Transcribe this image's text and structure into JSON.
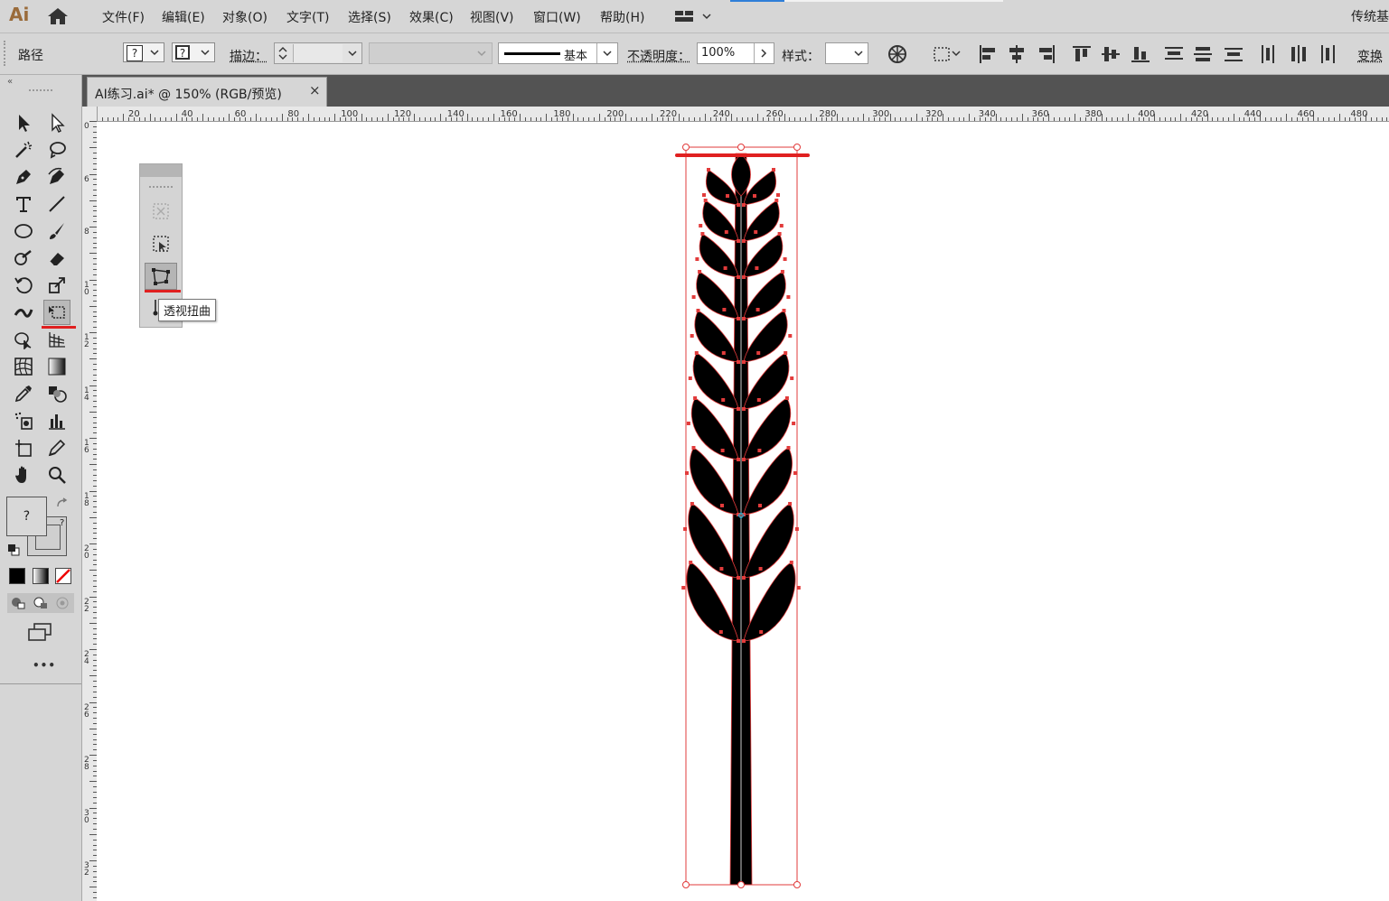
{
  "app": {
    "logo": "Ai",
    "workspace": "传统基"
  },
  "menu": [
    "文件(F)",
    "编辑(E)",
    "对象(O)",
    "文字(T)",
    "选择(S)",
    "效果(C)",
    "视图(V)",
    "窗口(W)",
    "帮助(H)"
  ],
  "control_bar": {
    "selection_type": "路径",
    "fill_swatch": "?",
    "stroke_swatch": "?",
    "stroke_label": "描边：",
    "stroke_profile": "基本",
    "opacity_label": "不透明度：",
    "opacity_value": "100%",
    "style_label": "样式：",
    "transform_label": "变换"
  },
  "document_tab": {
    "title": "AI练习.ai* @ 150% (RGB/预览)",
    "close": "×"
  },
  "ruler_h": [
    "20",
    "40",
    "60",
    "80",
    "100",
    "120",
    "140",
    "160",
    "180",
    "200",
    "220",
    "240",
    "260",
    "280",
    "300",
    "320",
    "340",
    "360",
    "380",
    "400",
    "420",
    "440",
    "460",
    "480"
  ],
  "ruler_v": [
    "0",
    "6",
    "8",
    "10",
    "12",
    "14",
    "16",
    "18",
    "20",
    "22",
    "24",
    "26",
    "28",
    "30",
    "32"
  ],
  "tools_panel": {
    "fill_stroke_label": "?",
    "more": "•••"
  },
  "flyout": {
    "tooltip": "透视扭曲"
  },
  "colors": {
    "ui_bg": "#d6d6d6",
    "selection": "#e23b3b",
    "annotation": "#e02020",
    "artwork": "#000000"
  }
}
